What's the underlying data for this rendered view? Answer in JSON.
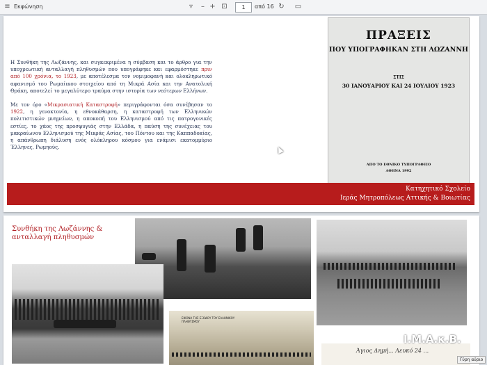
{
  "toolbar": {
    "menu_icon": "list-icon",
    "read_aloud_label": "Εκφώνηση",
    "zoom_out_symbol": "–",
    "zoom_in_symbol": "+",
    "page_current": "1",
    "page_total_label": "από 16"
  },
  "slide1": {
    "para1": {
      "part1": "Η Συνθήκη της Λωζάννης, και συγκεκριμένα η σύμβαση και το άρθρο για την υποχρεωτική ανταλλαγή πληθυσμών που υπογράφηκε και εφαρμόστηκε ",
      "highlight": "πριν από 100 χρόνια, το 1923",
      "part2": ", με αποτέλεσμα τον νομιμοφανή και ολοκληρωτικό αφανισμό του Ρωμαίικου στοιχείου από τη Μικρά Ασία και την Ανατολική Θράκη, αποτελεί το μεγαλύτερο τραύμα στην ιστορία των νεότερων Ελλήνων."
    },
    "para2": {
      "part1": "Με τον όρο «",
      "term": "Μικρασιατική Καταστροφή",
      "part2": "» περιγράφονται όσα συνέβησαν το ",
      "year": "1922",
      "part3": ", η γενοκτονία, η εθνοκάθαρση, η καταστροφή των Ελληνικών πολιτιστικών μνημείων, η αποκοπή του Ελληνισμού από τις πατρογονικές εστίες, το χάος της προσφυγιάς στην Ελλάδα, η παύση της συνέχειας του μακραίωνου Ελληνισμού της Μικράς Ασίας, του Πόντου και της Καππαδοκίας, η απάνθρωπη διάλυση ενός ολόκληρου κόσμου για ενάμισι εκατομμύριο Έλληνες, Ρωμηούς."
    },
    "cover": {
      "title": "ΠΡΑΞΕΙΣ",
      "subtitle": "ΠΟΥ ΥΠΟΓΡΑΦΗΚΑΝ ΣΤΗ ΛΩΖΑΝΝΗ",
      "stis": "ΣΤΙΣ",
      "dates": "30 ΙΑΝΟΥΑΡΙΟΥ ΚΑΙ 24 ΙΟΥΛΙΟΥ 1923",
      "publisher": "ΑΠΟ ΤΟ ΕΘΝΙΚΟ ΤΥΠΟΓΡΑΦΕΙΟ",
      "place_year": "ΑΘΗΝΑ 1992"
    },
    "banner": {
      "line1": "Κατηχητικό Σχολείο",
      "line2": "Ιεράς Μητροπόλεως Αττικής & Βοιωτίας"
    }
  },
  "slide2": {
    "title_line1": "Συνθήκη της Λωζάννης &",
    "title_line2": "ανταλλαγή πληθυσμών",
    "photo4_caption": "ΕΙΚΟΝΑ ΤΗΣ ΕΞΟΔΟΥ ΤΟΥ ΕΛΛΗΝΙΚΟΥ ΠΛΗΘΥΣΜΟΥ",
    "photo5_handwriting": "Άγιος Δημή... Λευκό 24 ..."
  },
  "watermark": "Ι.Μ.Α.κ.Β.",
  "tooltip": "Γύρη αύριο",
  "colors": {
    "banner_red": "#b71c1c",
    "accent_red": "#b11f24",
    "text_navy": "#1f2d4d"
  }
}
